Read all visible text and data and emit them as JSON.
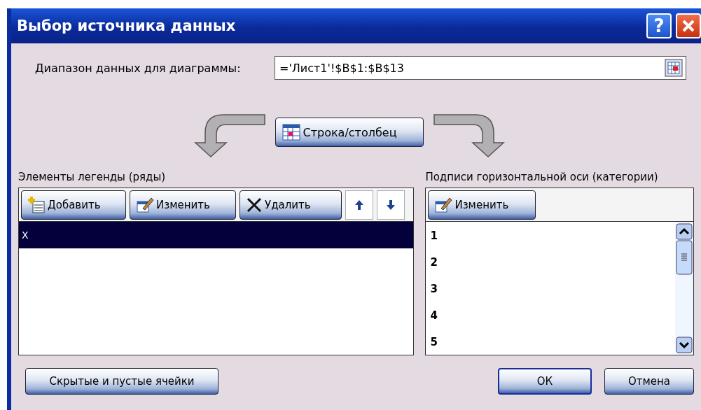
{
  "window": {
    "title": "Выбор источника данных",
    "help": "?"
  },
  "range": {
    "label": "Диапазон данных для диаграммы:",
    "value": "='Лист1'!$B$1:$B$13"
  },
  "switch_button": "Строка/столбец",
  "legend": {
    "label": "Элементы легенды (ряды)",
    "toolbar": [
      {
        "kind": "add",
        "label": "Добавить"
      },
      {
        "kind": "edit",
        "label": "Изменить"
      },
      {
        "kind": "delete",
        "label": "Удалить"
      },
      {
        "kind": "up"
      },
      {
        "kind": "down"
      }
    ],
    "items": [
      {
        "label": "X",
        "selected": true
      }
    ]
  },
  "categories": {
    "label": "Подписи горизонтальной оси (категории)",
    "edit_button": "Изменить",
    "items": [
      "1",
      "2",
      "3",
      "4",
      "5"
    ]
  },
  "footer": {
    "hidden_cells": "Скрытые и пустые ячейки",
    "ok": "ОК",
    "cancel": "Отмена"
  }
}
